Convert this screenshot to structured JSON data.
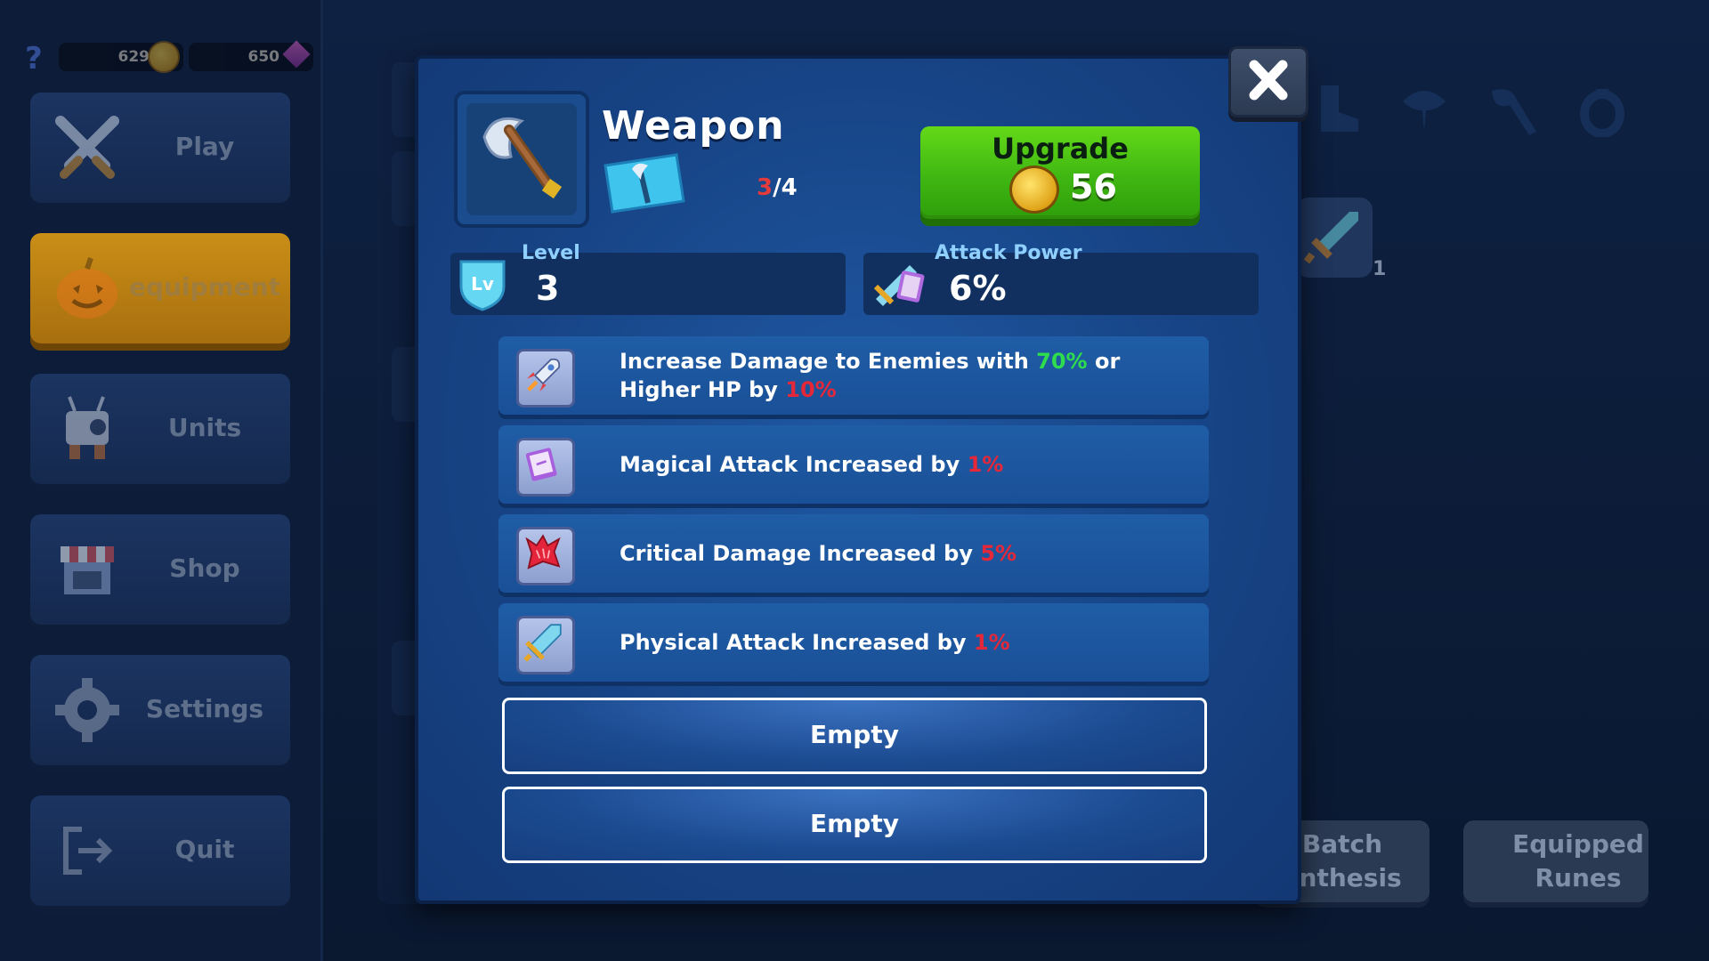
{
  "currency": {
    "help_icon": "question-mark",
    "gold": "629",
    "gems": "650"
  },
  "nav": {
    "items": [
      {
        "label": "Play",
        "icon": "crossed-swords-icon"
      },
      {
        "label": "equipment",
        "icon": "pumpkin-icon",
        "active": true
      },
      {
        "label": "Units",
        "icon": "robot-icon"
      },
      {
        "label": "Shop",
        "icon": "shop-stall-icon"
      },
      {
        "label": "Settings",
        "icon": "gear-icon"
      },
      {
        "label": "Quit",
        "icon": "exit-icon"
      }
    ]
  },
  "background": {
    "card_count": "1",
    "batch_synthesis_label": "Batch\nynthesis",
    "equipped_runes_label": "Equipped\nRunes"
  },
  "modal": {
    "title": "Weapon",
    "count_current": "3",
    "count_total": "/4",
    "upgrade_label": "Upgrade",
    "upgrade_cost": "56",
    "level_label": "Level",
    "level_value": "3",
    "attack_label": "Attack Power",
    "attack_value": "6%",
    "attributes": [
      {
        "icon": "rocket-icon",
        "text_a": "Increase Damage to Enemies with ",
        "hl1": "70%",
        "text_b": " or Higher HP by ",
        "hl2": "10%"
      },
      {
        "icon": "spellbook-icon",
        "text": "Magical Attack Increased by ",
        "value": "1%"
      },
      {
        "icon": "claw-burst-icon",
        "text": "Critical Damage Increased by ",
        "value": "5%"
      },
      {
        "icon": "sword-icon",
        "text": "Physical Attack Increased by ",
        "value": "1%"
      }
    ],
    "empty_slots": [
      "Empty",
      "Empty"
    ]
  },
  "colors": {
    "accent_green": "#3fb712",
    "highlight_red": "#e4283a",
    "highlight_green": "#2fdc4d",
    "modal_blue": "#174486"
  }
}
